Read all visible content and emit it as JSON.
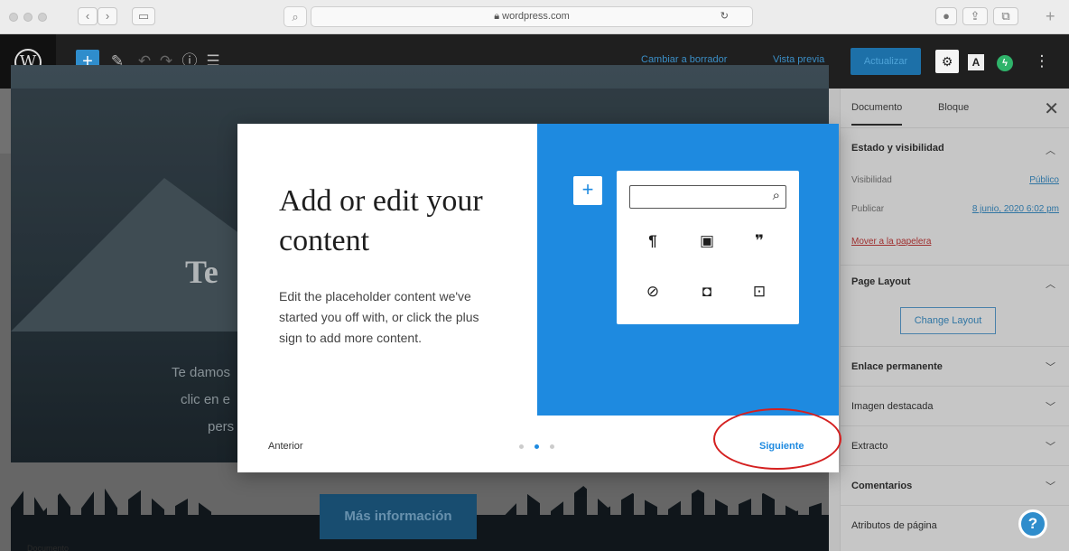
{
  "browser": {
    "url": "wordpress.com",
    "back_icon": "chevron-left-icon",
    "forward_icon": "chevron-right-icon"
  },
  "toolbar": {
    "switch_to_draft": "Cambiar a borrador",
    "preview": "Vista previa",
    "publish": "Actualizar",
    "plus": "+",
    "astra": "A"
  },
  "editor": {
    "hero_title": "Te",
    "hero_line1": "Te damos",
    "hero_line2": "clic en e",
    "hero_line3": "pers",
    "hero_button": "Más información",
    "footer": "Documento"
  },
  "sidebar": {
    "tab_document": "Documento",
    "tab_block": "Bloque",
    "status_heading": "Estado y visibilidad",
    "visibility_label": "Visibilidad",
    "visibility_value": "Público",
    "publish_label": "Publicar",
    "publish_value": "8 junio, 2020 6:02 pm",
    "trash": "Mover a la papelera",
    "page_layout_heading": "Page Layout",
    "change_layout": "Change Layout",
    "permalink": "Enlace permanente",
    "featured_image": "Imagen destacada",
    "excerpt": "Extracto",
    "comments": "Comentarios",
    "page_attributes": "Atributos de página"
  },
  "modal": {
    "title": "Add or edit your content",
    "body": "Edit the placeholder content we've started you off with, or click the plus sign to add more content.",
    "previous": "Anterior",
    "next": "Siguiente",
    "plus": "+",
    "current_step": 2,
    "total_steps": 3
  },
  "colors": {
    "accent": "#1e8ae0",
    "annotation": "#d42020"
  }
}
